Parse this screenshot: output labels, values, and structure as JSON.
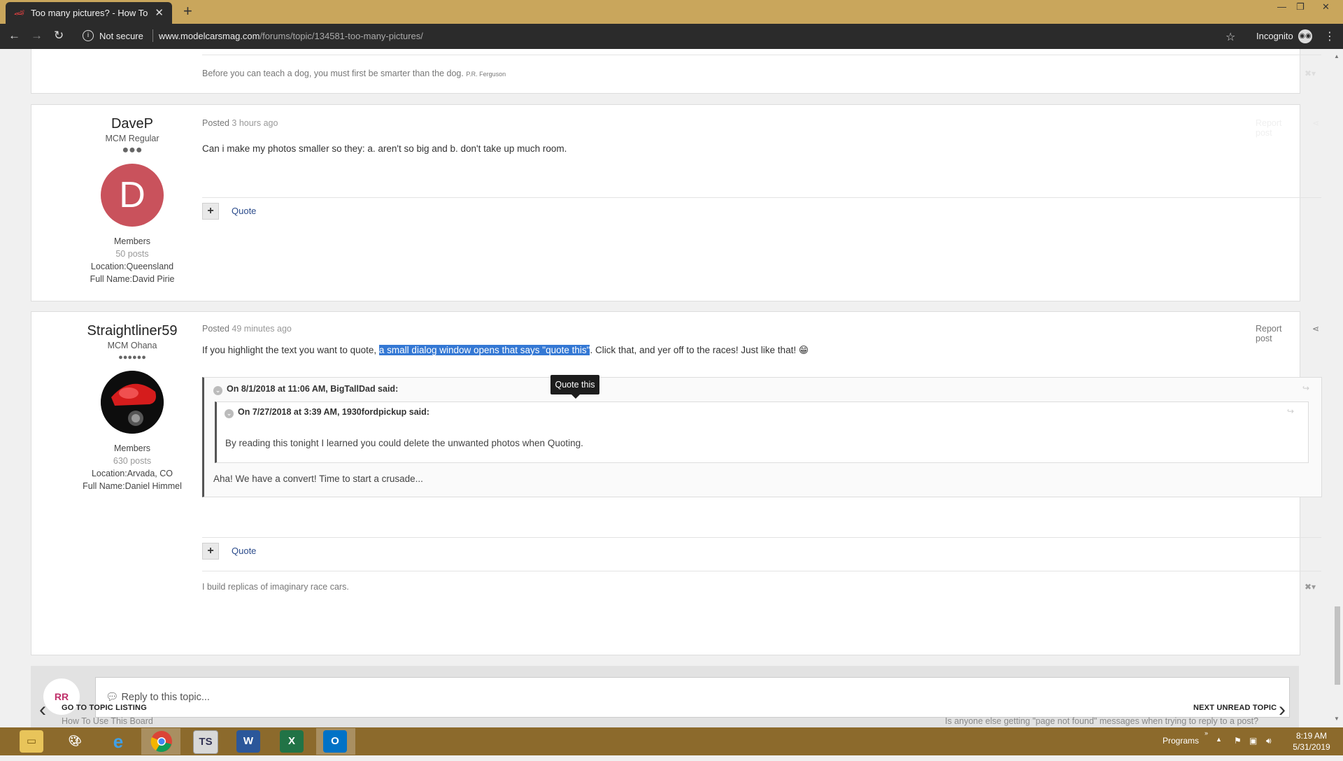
{
  "browser": {
    "tab_title": "Too many pictures? - How To Use",
    "new_tab": "+",
    "security_label": "Not secure",
    "url_host": "www.modelcarsmag.com",
    "url_path": "/forums/topic/134581-too-many-pictures/",
    "incognito_label": "Incognito"
  },
  "prev_post": {
    "signature": "Before you can teach a dog, you must first be smarter than the dog.",
    "signature_author": "P.R. Ferguson"
  },
  "posts": [
    {
      "author": "DaveP",
      "rank": "MCM Regular",
      "pips": "●●●",
      "avatar_letter": "D",
      "avatar_color": "#c9525c",
      "group": "Members",
      "post_count": "50 posts",
      "location": "Location:Queensland",
      "full_name": "Full Name:David Pirie",
      "posted_prefix": "Posted",
      "posted_ago": "3 hours ago",
      "report_label": "Report post",
      "body": "Can i make my photos smaller so they: a. aren't so big and b. don't take up much room.",
      "quote_label": "Quote",
      "plus": "+"
    },
    {
      "author": "Straightliner59",
      "rank": "MCM Ohana",
      "pips": "●●●●●●",
      "group": "Members",
      "post_count": "630 posts",
      "location": "Location:Arvada, CO",
      "full_name": "Full Name:Daniel Himmel",
      "posted_prefix": "Posted",
      "posted_ago": "49 minutes ago",
      "report_label": "Report post",
      "body_before": "If you highlight the text you want to quote, ",
      "body_highlight": "a small dialog window opens that says \"quote this\"",
      "body_after": ". Click that, and yer off to the races! Just like that! 😁",
      "outer_quote_header": "On 8/1/2018 at 11:06 AM, BigTallDad said:",
      "inner_quote_header": "On 7/27/2018 at 3:39 AM, 1930fordpickup said:",
      "inner_quote_text": "By reading this tonight I learned you could delete the unwanted photos when Quoting.",
      "outer_quote_text": "Aha! We have a convert! Time to start a crusade...",
      "quote_label": "Quote",
      "plus": "+",
      "signature": "I build replicas of imaginary race cars."
    }
  ],
  "tooltip": "Quote this",
  "reply": {
    "placeholder": "Reply to this topic...",
    "avatar_text": "RR"
  },
  "nav": {
    "prev_heading": "GO TO TOPIC LISTING",
    "prev_sub": "How To Use This Board",
    "next_heading": "NEXT UNREAD TOPIC",
    "next_sub": "Is anyone else getting \"page not found\" messages when trying to reply to a post?"
  },
  "taskbar": {
    "programs_label": "Programs",
    "time": "8:19 AM",
    "date": "5/31/2019",
    "apps": [
      "file-explorer",
      "paint",
      "internet-explorer",
      "chrome",
      "teamspeak",
      "word",
      "excel",
      "outlook"
    ]
  },
  "colors": {
    "tabstrip": "#c9a65c",
    "chrome_dark": "#2b2b2b",
    "selection": "#3478d4",
    "taskbar": "#8c6a2c",
    "link": "#2c4c8c"
  }
}
